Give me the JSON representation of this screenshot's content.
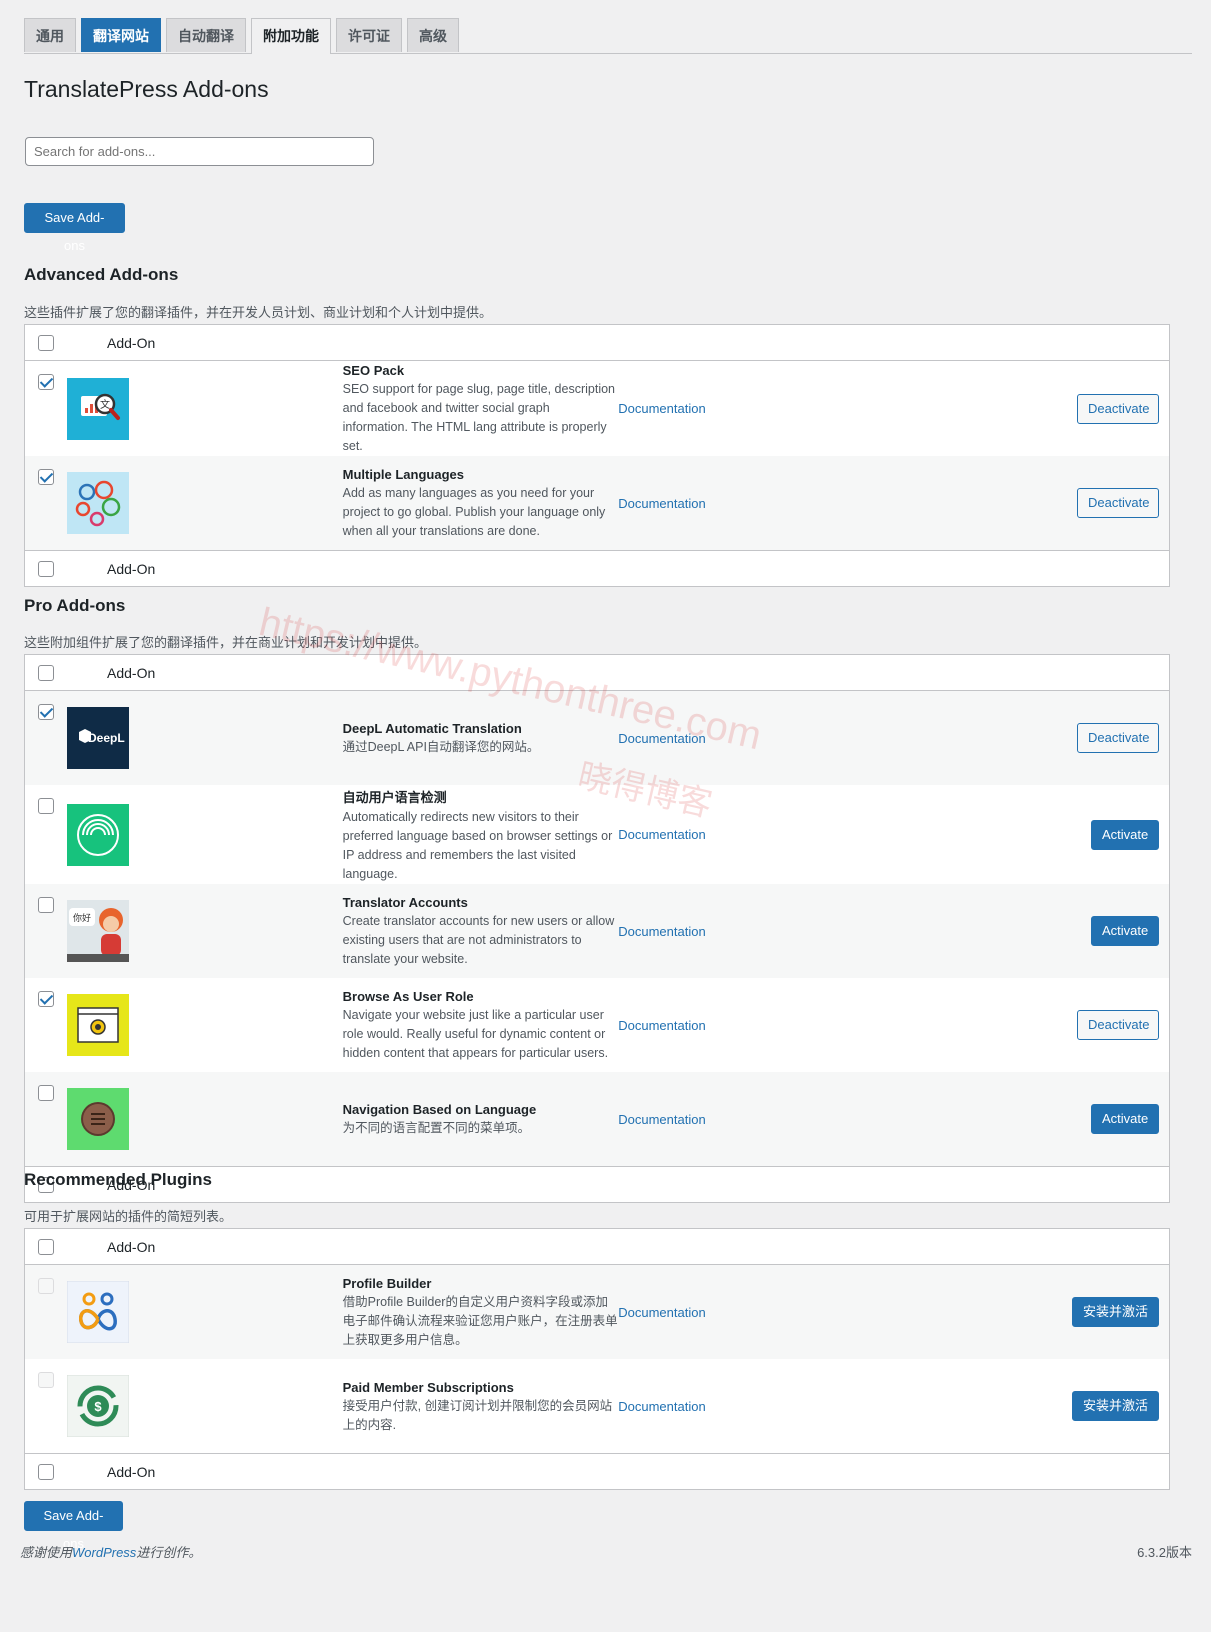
{
  "tabs": [
    "通用",
    "翻译网站",
    "自动翻译",
    "附加功能",
    "许可证",
    "高级"
  ],
  "page_title": "TranslatePress Add-ons",
  "search": {
    "placeholder": "Search for add-ons..."
  },
  "save_label": "Save Add-ons",
  "column_label": "Add-On",
  "documentation_label": "Documentation",
  "deactivate_label": "Deactivate",
  "activate_label": "Activate",
  "install_label": "安装并激活",
  "advanced": {
    "title": "Advanced Add-ons",
    "desc": "这些插件扩展了您的翻译插件，并在开发人员计划、商业计划和个人计划中提供。",
    "items": [
      {
        "name": "SEO Pack",
        "desc": "SEO support for page slug, page title, description and facebook and twitter social graph information. The HTML lang attribute is properly set.",
        "checked": true,
        "icon": "seo-pack-icon"
      },
      {
        "name": "Multiple Languages",
        "desc": "Add as many languages as you need for your project to go global. Publish your language only when all your translations are done.",
        "checked": true,
        "icon": "multiple-languages-icon"
      }
    ]
  },
  "pro": {
    "title": "Pro Add-ons",
    "desc": "这些附加组件扩展了您的翻译插件，并在商业计划和开发计划中提供。",
    "items": [
      {
        "name": "DeepL Automatic Translation",
        "desc": "通过DeepL API自动翻译您的网站。",
        "checked": true,
        "icon": "deepl-icon",
        "logo_text": "DeepL"
      },
      {
        "name": "自动用户语言检测",
        "desc": "Automatically redirects new visitors to their preferred language based on browser settings or IP address and remembers the last visited language.",
        "checked": false,
        "icon": "language-detection-icon"
      },
      {
        "name": "Translator Accounts",
        "desc": "Create translator accounts for new users or allow existing users that are not administrators to translate your website.",
        "checked": false,
        "icon": "translator-accounts-icon",
        "bubble_text": "你好"
      },
      {
        "name": "Browse As User Role",
        "desc": "Navigate your website just like a particular user role would. Really useful for dynamic content or hidden content that appears for particular users.",
        "checked": true,
        "icon": "browse-as-role-icon"
      },
      {
        "name": "Navigation Based on Language",
        "desc": "为不同的语言配置不同的菜单项。",
        "checked": false,
        "icon": "navigation-menu-icon"
      }
    ]
  },
  "recommended": {
    "title": "Recommended Plugins",
    "desc": "可用于扩展网站的插件的简短列表。",
    "items": [
      {
        "name": "Profile Builder",
        "desc": "借助Profile Builder的自定义用户资料字段或添加电子邮件确认流程来验证您用户账户，在注册表单上获取更多用户信息。",
        "icon": "profile-builder-icon"
      },
      {
        "name": "Paid Member Subscriptions",
        "desc": "接受用户付款, 创建订阅计划并限制您的会员网站上的内容.",
        "icon": "paid-member-subscriptions-icon"
      }
    ]
  },
  "footer": {
    "prefix": "感谢使用",
    "link": "WordPress",
    "suffix": "进行创作。",
    "version": "6.3.2版本"
  },
  "watermark": {
    "url": "https://www.pythonthree.com",
    "name": "晓得博客"
  },
  "colors": {
    "primary": "#2271b1",
    "background": "#f0f0f1",
    "border": "#c3c4c7"
  }
}
